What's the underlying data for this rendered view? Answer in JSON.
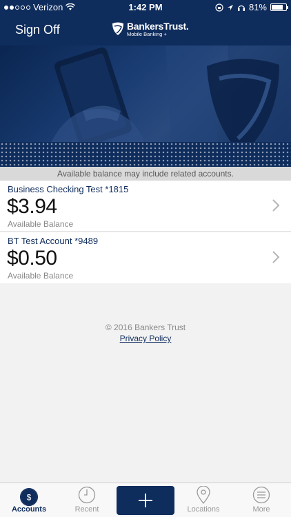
{
  "status_bar": {
    "carrier": "Verizon",
    "time": "1:42 PM",
    "battery": "81%",
    "battery_level": 0.81
  },
  "nav": {
    "sign_off_label": "Sign Off",
    "logo_name": "BankersTrust.",
    "logo_sub": "Mobile Banking +"
  },
  "notice": "Available balance may include related accounts.",
  "accounts": [
    {
      "name": "Business Checking Test *1815",
      "balance": "$3.94",
      "label": "Available Balance"
    },
    {
      "name": "BT Test Account *9489",
      "balance": "$0.50",
      "label": "Available Balance"
    }
  ],
  "footer": {
    "copyright": "© 2016 Bankers Trust",
    "privacy": "Privacy Policy"
  },
  "tabs": [
    {
      "label": "Accounts",
      "icon": "accounts-dollar-icon",
      "active": true
    },
    {
      "label": "Recent",
      "icon": "clock-icon",
      "active": false
    },
    {
      "label": "",
      "icon": "plus-icon",
      "active": false
    },
    {
      "label": "Locations",
      "icon": "location-pin-icon",
      "active": false
    },
    {
      "label": "More",
      "icon": "menu-icon",
      "active": false
    }
  ],
  "colors": {
    "brand_navy": "#0e2c5c",
    "background": "#f2f2f2",
    "notice_bg": "#d9d9d9"
  }
}
